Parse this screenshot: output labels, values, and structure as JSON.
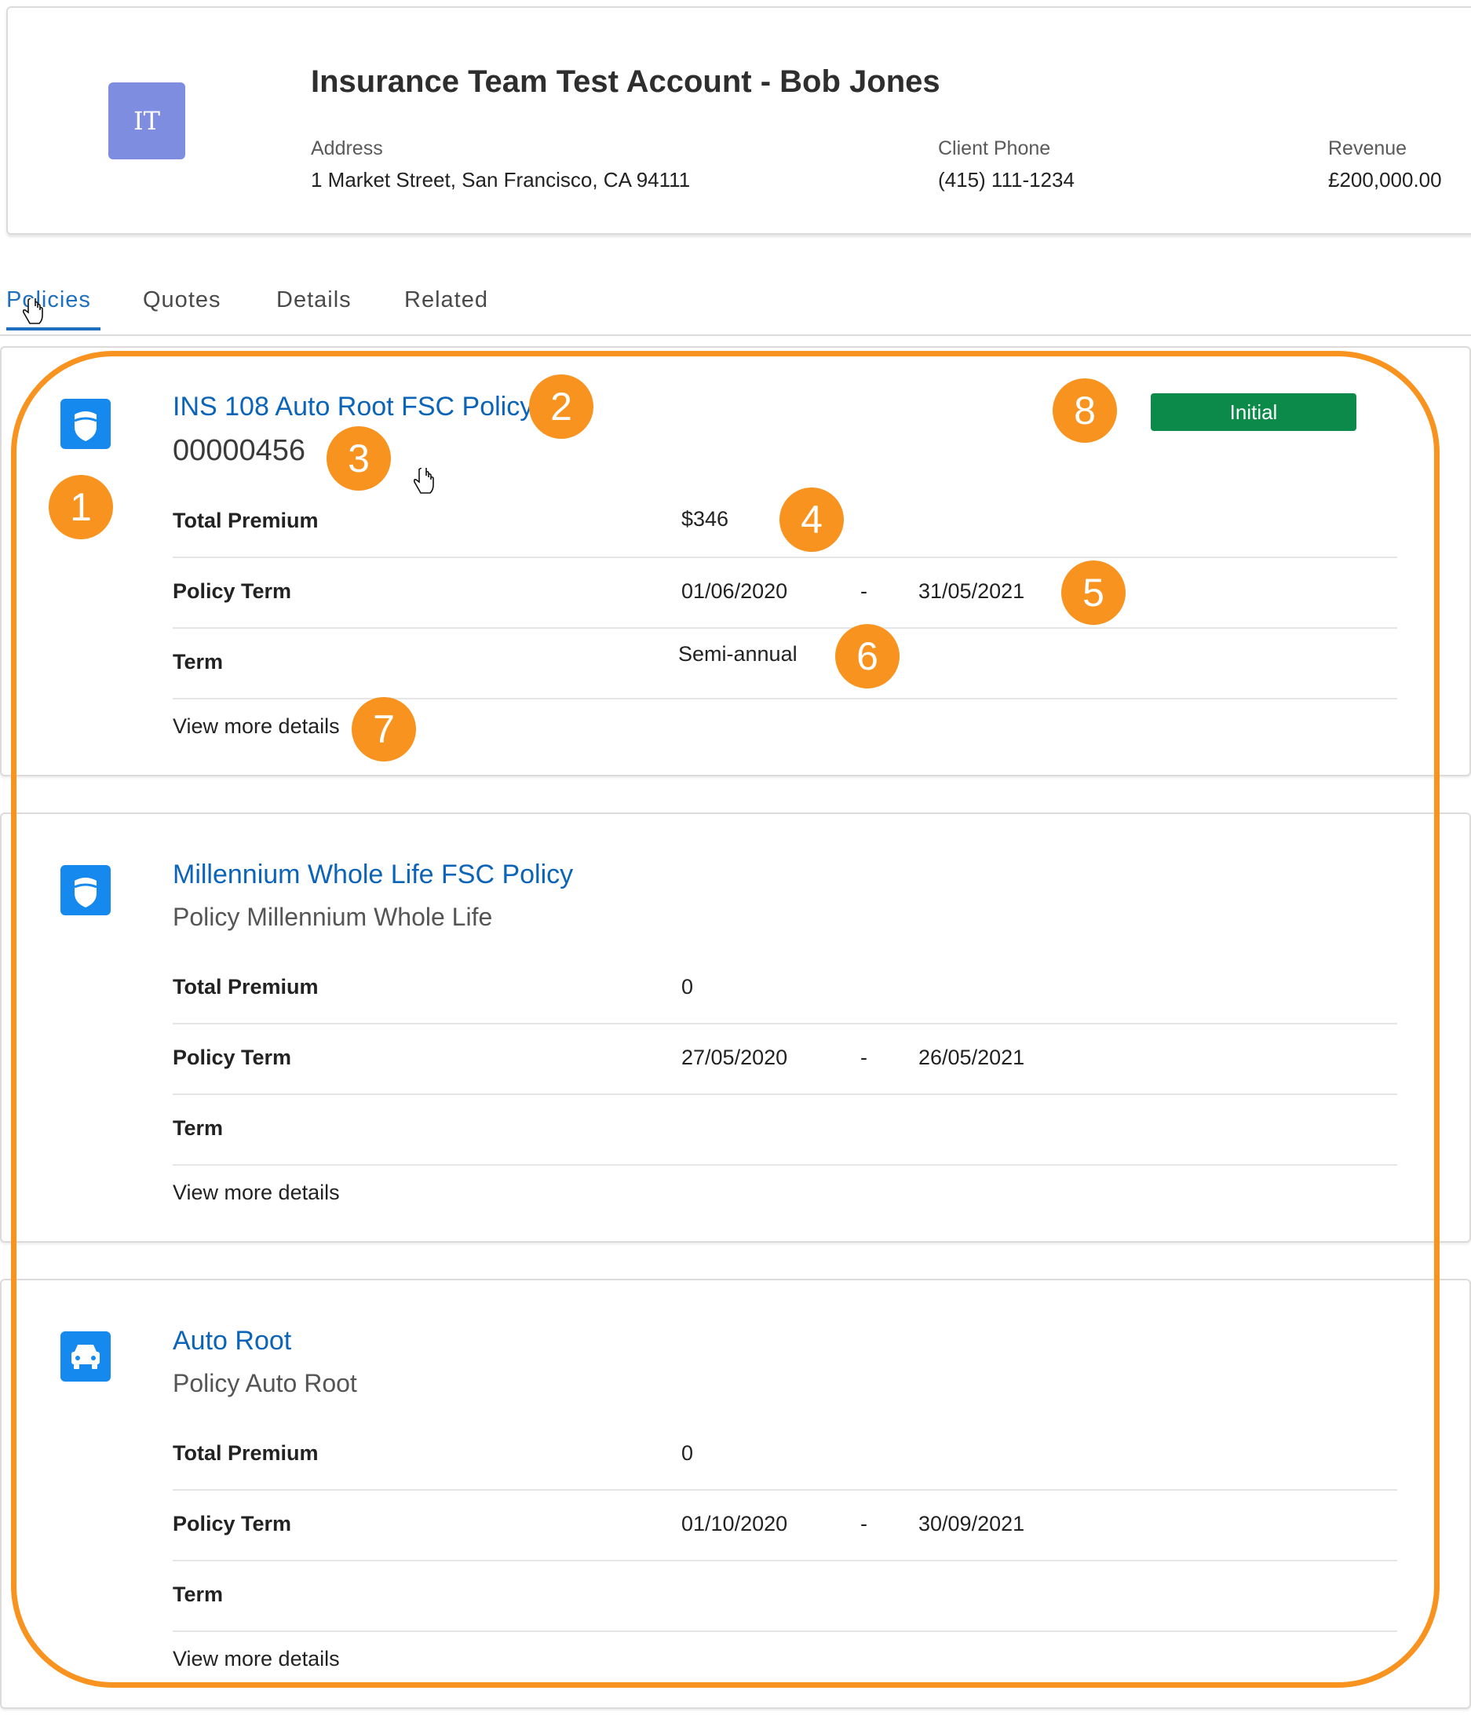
{
  "account": {
    "initials": "IT",
    "title": "Insurance Team Test Account - Bob Jones",
    "fields": [
      {
        "label": "Address",
        "value": "1 Market Street, San Francisco, CA 94111"
      },
      {
        "label": "Client Phone",
        "value": "(415) 111-1234"
      },
      {
        "label": "Revenue",
        "value": "£200,000.00"
      }
    ]
  },
  "tabs": [
    "Policies",
    "Quotes",
    "Details",
    "Related"
  ],
  "active_tab": "Policies",
  "policies": [
    {
      "icon": "shield-icon",
      "name": "INS 108 Auto Root FSC Policy",
      "subtitle": "00000456",
      "status": "Initial",
      "total_premium_label": "Total Premium",
      "total_premium": "$346",
      "policy_term_label": "Policy Term",
      "term_start": "01/06/2020",
      "term_separator": "-",
      "term_end": "31/05/2021",
      "term_label": "Term",
      "term": "Semi-annual",
      "more_label": "View more details"
    },
    {
      "icon": "shield-icon",
      "name": "Millennium Whole Life FSC Policy",
      "subtitle": "Policy Millennium Whole Life",
      "total_premium_label": "Total Premium",
      "total_premium": "0",
      "policy_term_label": "Policy Term",
      "term_start": "27/05/2020",
      "term_separator": "-",
      "term_end": "26/05/2021",
      "term_label": "Term",
      "term": "",
      "more_label": "View more details"
    },
    {
      "icon": "car-icon",
      "name": "Auto Root",
      "subtitle": "Policy Auto Root",
      "total_premium_label": "Total Premium",
      "total_premium": "0",
      "policy_term_label": "Policy Term",
      "term_start": "01/10/2020",
      "term_separator": "-",
      "term_end": "30/09/2021",
      "term_label": "Term",
      "term": "",
      "more_label": "View more details"
    }
  ],
  "callouts": [
    "1",
    "2",
    "3",
    "4",
    "5",
    "6",
    "7",
    "8"
  ],
  "colors": {
    "callout": "#f7931e",
    "link": "#0b64b8",
    "status_badge": "#0b8a4a",
    "icon_bg": "#1589ee",
    "avatar_bg": "#7f8de1"
  }
}
